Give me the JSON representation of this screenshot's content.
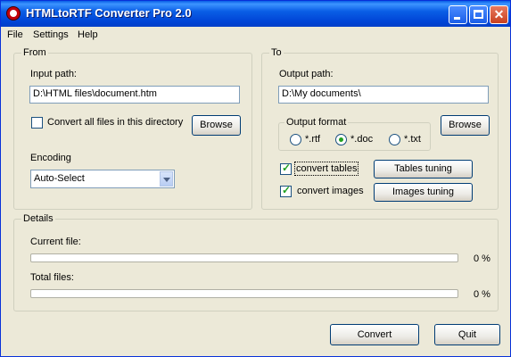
{
  "window": {
    "title": "HTMLtoRTF Converter Pro 2.0",
    "close_glyph": "✕"
  },
  "menu": [
    "File",
    "Settings",
    "Help"
  ],
  "from": {
    "group_label": "From",
    "input_path_label": "Input path:",
    "input_path_value": "D:\\HTML files\\document.htm",
    "convert_all_label": "Convert all files in this directory",
    "convert_all_checked": false,
    "browse_label": "Browse",
    "encoding_label": "Encoding",
    "encoding_value": "Auto-Select"
  },
  "to": {
    "group_label": "To",
    "output_path_label": "Output path:",
    "output_path_value": "D:\\My documents\\",
    "browse_label": "Browse",
    "output_format_label": "Output format",
    "formats": [
      {
        "label": "*.rtf",
        "selected": false
      },
      {
        "label": "*.doc",
        "selected": true
      },
      {
        "label": "*.txt",
        "selected": false
      }
    ],
    "convert_tables_label": "convert tables",
    "convert_tables_checked": true,
    "convert_images_label": "convert images",
    "convert_images_checked": true,
    "tables_tuning_label": "Tables tuning",
    "images_tuning_label": "Images tuning"
  },
  "details": {
    "group_label": "Details",
    "current_file_label": "Current file:",
    "current_file_progress": 0,
    "current_file_percent": "0 %",
    "total_files_label": "Total files:",
    "total_files_progress": 0,
    "total_files_percent": "0 %"
  },
  "actions": {
    "convert_label": "Convert",
    "quit_label": "Quit"
  },
  "colors": {
    "titlebar": "#0a5ee6",
    "window_face": "#ece9d8",
    "check_mark": "#21a121"
  }
}
